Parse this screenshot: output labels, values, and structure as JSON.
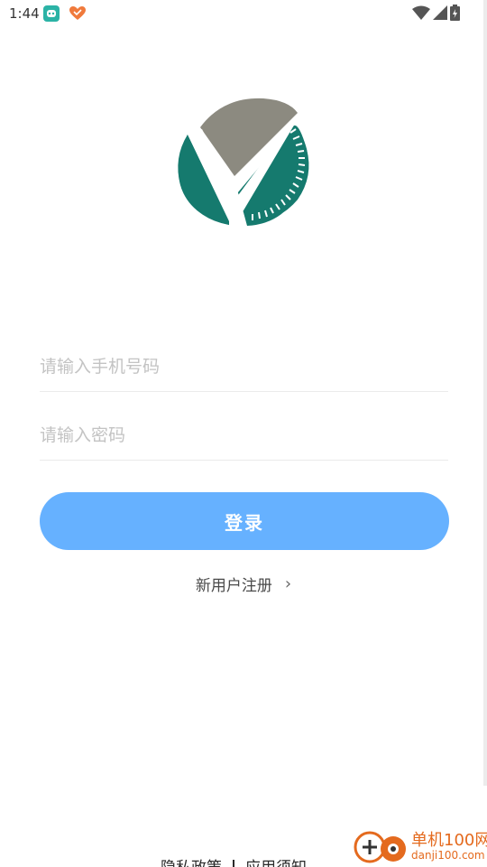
{
  "status_bar": {
    "time": "1:44"
  },
  "login_form": {
    "phone_placeholder": "请输入手机号码",
    "phone_value": "",
    "password_placeholder": "请输入密码",
    "password_value": "",
    "login_label": "登录",
    "register_label": "新用户注册",
    "register_chevron": "›"
  },
  "footer": {
    "privacy_label": "隐私政策",
    "agreement_label": "应用须知"
  },
  "watermark": {
    "name": "单机100网",
    "url": "danji100.com"
  },
  "colors": {
    "accent": "#66b1ff",
    "logo_teal": "#157a6e",
    "logo_gray": "#8c8a80",
    "watermark_orange": "#e46a1e"
  },
  "icons": [
    "wifi-icon",
    "signal-icon",
    "battery-icon",
    "app-logo",
    "chevron-right-icon"
  ]
}
